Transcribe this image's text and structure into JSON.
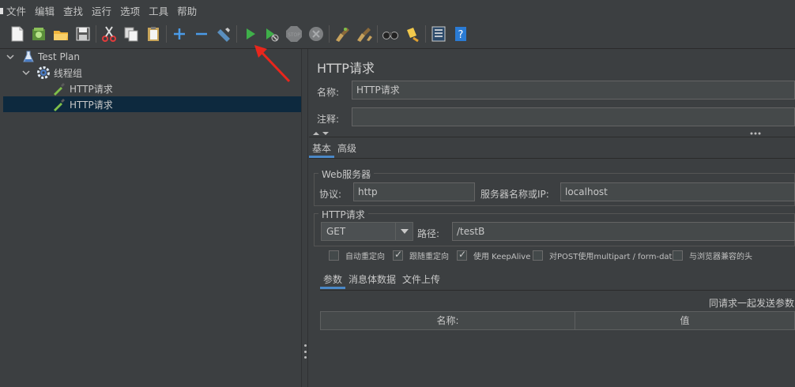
{
  "menu": [
    "文件",
    "编辑",
    "查找",
    "运行",
    "选项",
    "工具",
    "帮助"
  ],
  "toolbar": {
    "icons": [
      "new-icon",
      "templates-icon",
      "open-icon",
      "save-icon",
      "cut-icon",
      "copy-icon",
      "paste-icon",
      "expand-icon",
      "collapse-icon",
      "toggle-icon",
      "start-icon",
      "start-no-pauses-icon",
      "stop-icon",
      "shutdown-icon",
      "clear-icon",
      "clear-all-icon",
      "search-icon",
      "reset-search-icon",
      "function-helper-icon",
      "help-icon"
    ],
    "stop_label": "STOP"
  },
  "tree": {
    "items": [
      {
        "label": "Test Plan",
        "icon": "flask-icon"
      },
      {
        "label": "线程组",
        "icon": "gear-icon"
      },
      {
        "label": "HTTP请求",
        "icon": "pipette-icon"
      },
      {
        "label": "HTTP请求",
        "icon": "pipette-icon"
      }
    ]
  },
  "panel": {
    "title": "HTTP请求",
    "name_label": "名称:",
    "name_value": "HTTP请求",
    "comment_label": "注释:",
    "comment_value": "",
    "tabs": [
      "基本",
      "高级"
    ],
    "web_server": {
      "title": "Web服务器",
      "protocol_label": "协议:",
      "protocol_value": "http",
      "server_label": "服务器名称或IP:",
      "server_value": "localhost"
    },
    "http_request": {
      "title": "HTTP请求",
      "method": "GET",
      "path_label": "路径:",
      "path_value": "/testB"
    },
    "checkboxes": [
      {
        "label": "自动重定向",
        "checked": false
      },
      {
        "label": "跟随重定向",
        "checked": true
      },
      {
        "label": "使用 KeepAlive",
        "checked": true
      },
      {
        "label": "对POST使用multipart / form-data",
        "checked": false
      },
      {
        "label": "与浏览器兼容的头",
        "checked": false
      }
    ],
    "param_tabs": [
      "参数",
      "消息体数据",
      "文件上传"
    ],
    "send_params_label": "同请求一起发送参数:",
    "table_headers": [
      "名称:",
      "值"
    ]
  },
  "colors": {
    "background": "#3c3f41",
    "selected_row": "#0d293e",
    "active_tab": "#4a88c7",
    "annotation_arrow": "#e8261c"
  }
}
